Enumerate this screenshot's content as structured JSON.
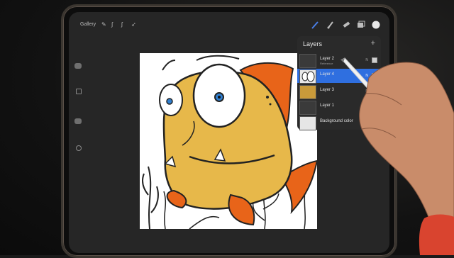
{
  "topbar": {
    "gallery_label": "Gallery",
    "left_tools": [
      "wrench-icon",
      "magic-wand-icon",
      "selection-icon",
      "transform-icon"
    ],
    "right_tools": [
      "brush-icon",
      "smudge-icon",
      "eraser-icon",
      "layers-icon",
      "color-icon"
    ]
  },
  "sidebar": [
    "brush-size-slider",
    "modify-button",
    "opacity-slider",
    "undo-button"
  ],
  "layers": {
    "title": "Layers",
    "add_label": "+",
    "items": [
      {
        "name": "Layer 2",
        "sub": "Reference",
        "n": "N",
        "selected": false
      },
      {
        "name": "Layer 4",
        "sub": "",
        "n": "N",
        "selected": true
      },
      {
        "name": "Layer 3",
        "sub": "",
        "n": "N",
        "selected": false
      },
      {
        "name": "Layer 1",
        "sub": "",
        "n": "N",
        "selected": false
      },
      {
        "name": "Background color",
        "sub": "",
        "n": "",
        "selected": false
      }
    ]
  },
  "colors": {
    "accent": "#2f6fe0",
    "fish_body": "#e7b84a",
    "fin": "#e86419"
  }
}
